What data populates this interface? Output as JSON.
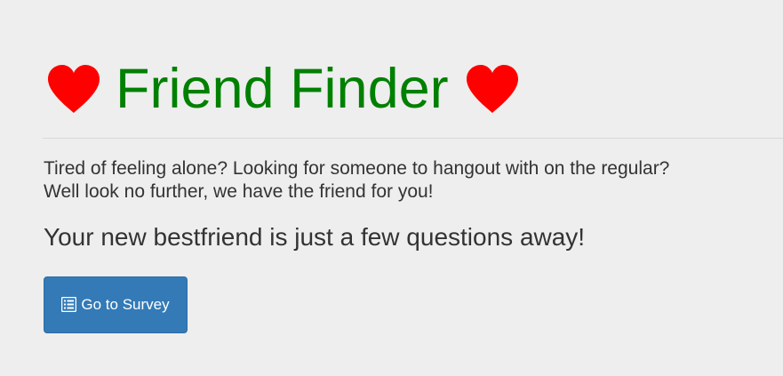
{
  "header": {
    "title": "Friend Finder",
    "left_icon": "heart-icon",
    "right_icon": "heart-icon"
  },
  "main": {
    "lead_line_1": "Tired of feeling alone? Looking for someone to hangout with on the regular?",
    "lead_line_2": "Well look no further, we have the friend for you!",
    "subheading": "Your new bestfriend is just a few questions away!",
    "survey_button": {
      "label": "Go to Survey",
      "icon": "list-alt-icon"
    }
  },
  "colors": {
    "background": "#eeeeee",
    "title": "#008000",
    "heart": "#ff0000",
    "button": "#337ab7",
    "text": "#333333"
  }
}
